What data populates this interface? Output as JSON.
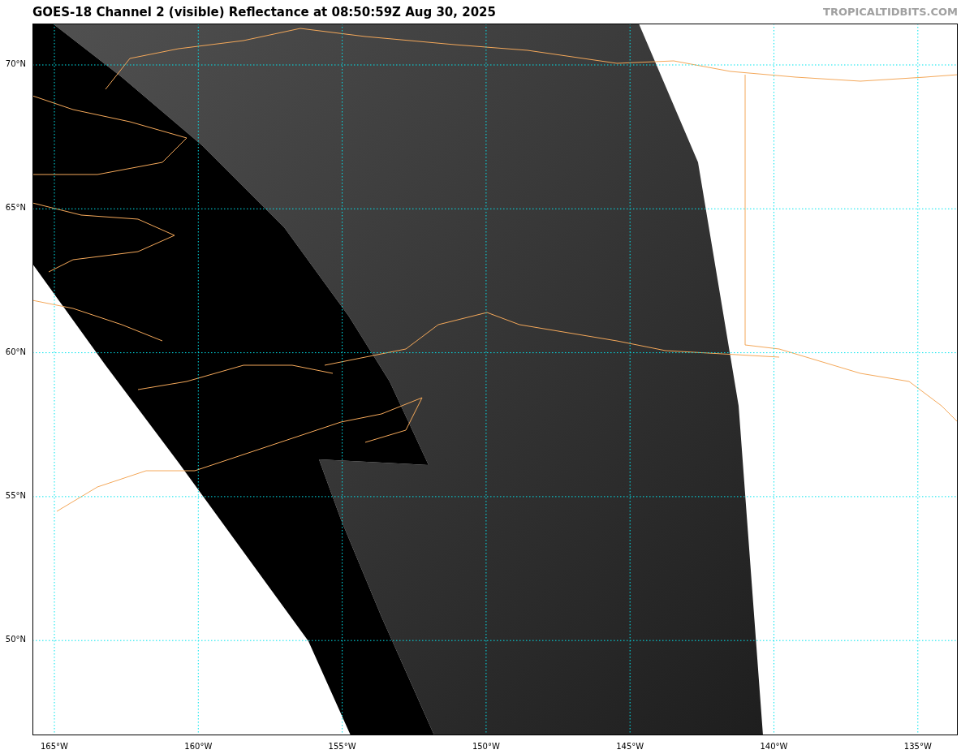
{
  "title": "GOES-18 Channel 2 (visible) Reflectance at 08:50:59Z Aug 30, 2025",
  "credit": "TROPICALTIDBITS.COM",
  "map": {
    "latitude_labels": [
      "70°N",
      "65°N",
      "60°N",
      "55°N",
      "50°N"
    ],
    "longitude_labels": [
      "165°W",
      "160°W",
      "155°W",
      "150°W",
      "145°W",
      "140°W",
      "135°W"
    ]
  }
}
